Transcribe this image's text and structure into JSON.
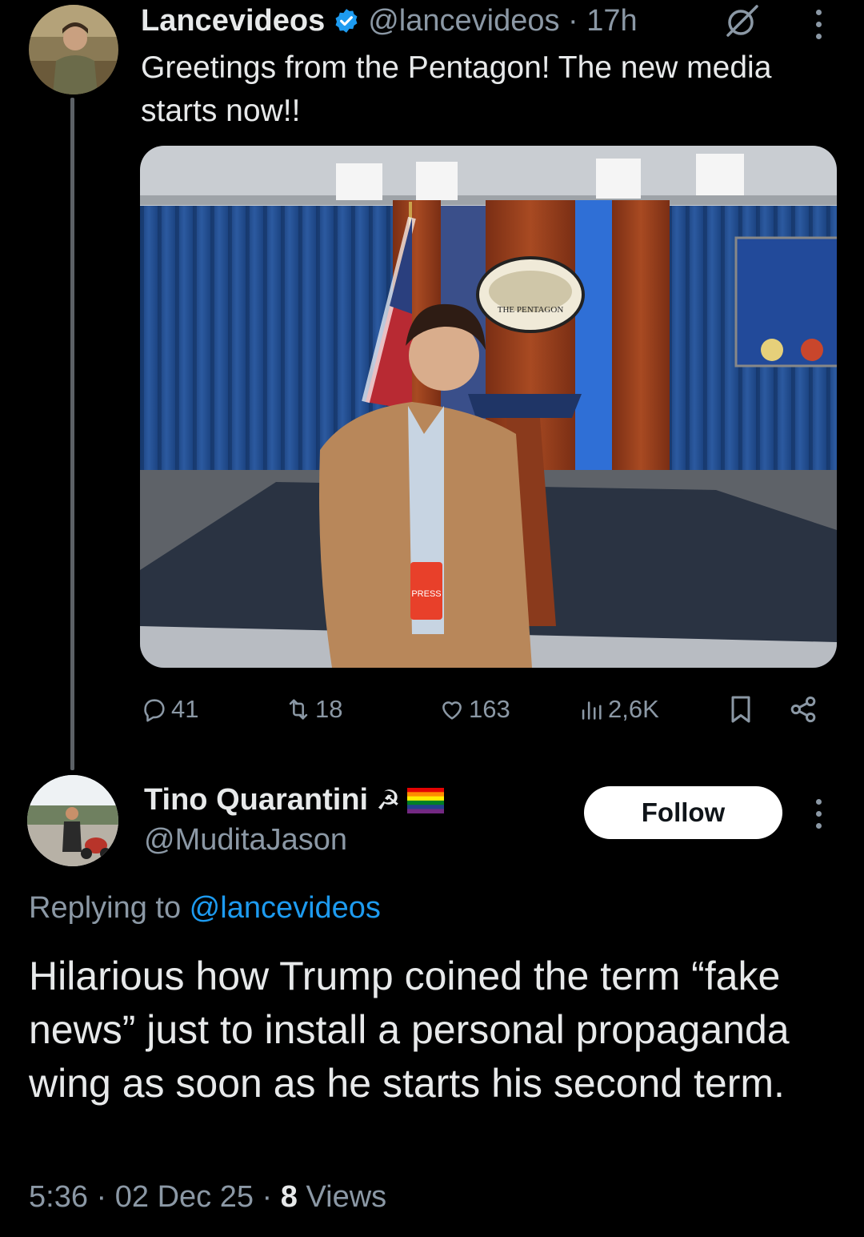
{
  "colors": {
    "accent": "#1d9bf0",
    "muted": "#8b98a5",
    "text": "#e7e9ea",
    "background": "#000000"
  },
  "tweet1": {
    "display_name": "Lancevideos",
    "handle": "@lancevideos",
    "separator": " · ",
    "time": "17h",
    "text": "Greetings from the Pentagon! The new media starts now!!",
    "image": {
      "podium_seal_text": "THE PENTAGON",
      "badge_text": "PRESS"
    },
    "actions": {
      "replies": "41",
      "reposts": "18",
      "likes": "163",
      "views": "2,6K"
    },
    "icons": [
      "verified-badge-icon",
      "ungrok-icon",
      "more-vertical-icon",
      "reply-icon",
      "repost-icon",
      "like-icon",
      "views-icon",
      "bookmark-icon",
      "share-icon"
    ]
  },
  "tweet2": {
    "display_name": "Tino Quarantini",
    "name_emoji": "☭",
    "handle": "@MuditaJason",
    "follow_label": "Follow",
    "replying_prefix": "Replying to ",
    "replying_handle": "@lancevideos",
    "text": "Hilarious how Trump coined the term “fake news” just to install a personal propaganda wing as soon as he starts his second term.",
    "time": "5:36",
    "date": "02 Dec 25",
    "views_count": "8",
    "views_label": "Views",
    "separator": " · "
  }
}
